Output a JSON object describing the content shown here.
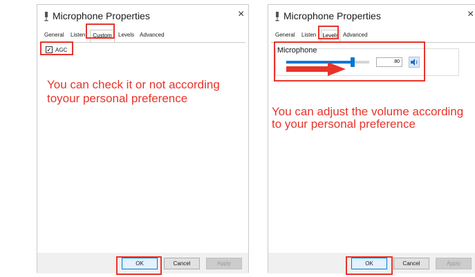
{
  "left_dialog": {
    "title": "Microphone Properties",
    "close": "×",
    "tabs": [
      "General",
      "Listen",
      "Custom",
      "Levels",
      "Advanced"
    ],
    "active_tab": "Custom",
    "agc_label": "AGC",
    "agc_checked": true,
    "annotation_line1": "You can check it or not according",
    "annotation_line2": " toyour personal preference",
    "buttons": {
      "ok": "OK",
      "cancel": "Cancel",
      "apply": "Apply"
    }
  },
  "right_dialog": {
    "title": "Microphone Properties",
    "close": "×",
    "tabs": [
      "General",
      "Listen",
      "Levels",
      "Advanced"
    ],
    "active_tab": "Levels",
    "device_label": "Microphone",
    "volume_value": "80",
    "volume_level": 80,
    "annotation_line1": "You can adjust the volume according",
    "annotation_line2": "to your personal preference",
    "buttons": {
      "ok": "OK",
      "cancel": "Cancel",
      "apply": "Apply"
    }
  },
  "colors": {
    "annotation_red": "#e8332a",
    "accent_blue": "#0078d7",
    "footer_gray": "#f0f0f0"
  }
}
